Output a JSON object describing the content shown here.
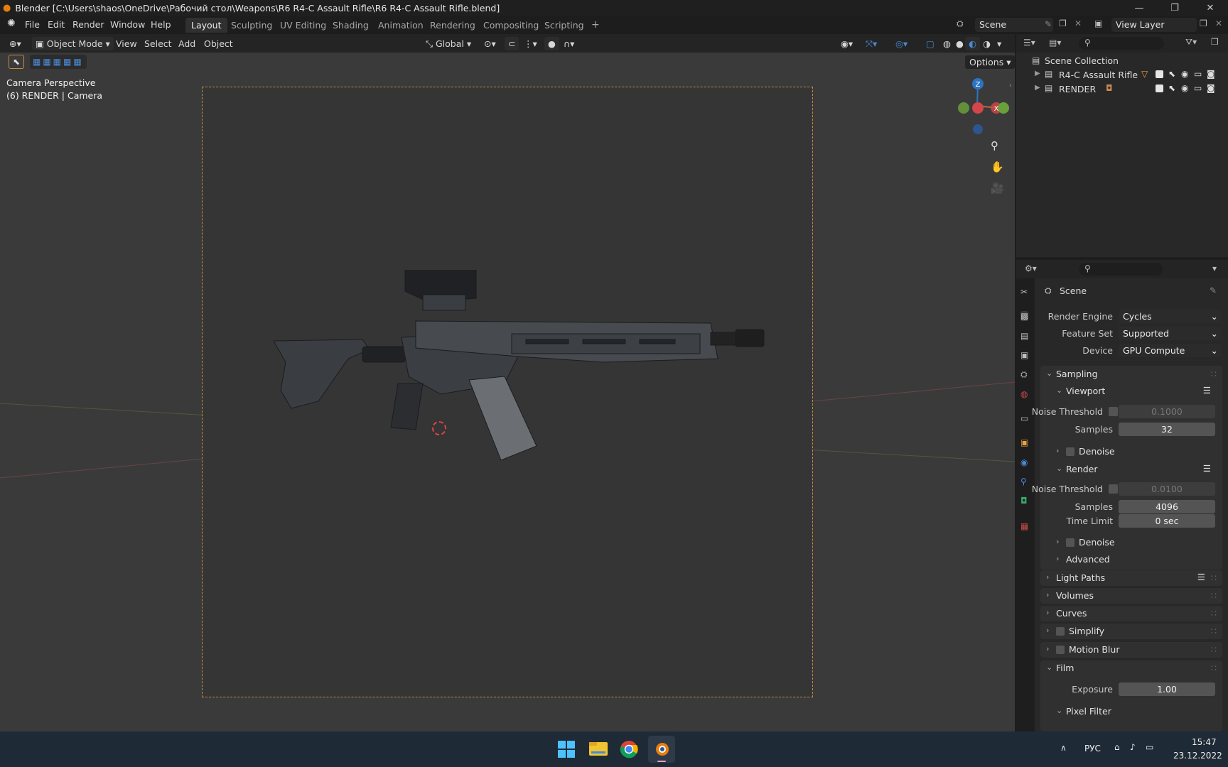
{
  "window": {
    "title": "Blender [C:\\Users\\shaos\\OneDrive\\Рабочий стол\\Weapons\\R6 R4-C Assault Rifle\\R6 R4-C Assault Rifle.blend]",
    "minimize": "—",
    "maximize": "❐",
    "close": "✕"
  },
  "menu": [
    "File",
    "Edit",
    "Render",
    "Window",
    "Help"
  ],
  "workspaces": [
    "Layout",
    "Sculpting",
    "UV Editing",
    "Shading",
    "Animation",
    "Rendering",
    "Compositing",
    "Scripting",
    "+"
  ],
  "scene": {
    "label": "Scene",
    "view_layer": "View Layer"
  },
  "viewport_header": {
    "mode": "Object Mode",
    "view": "View",
    "select": "Select",
    "add": "Add",
    "object": "Object",
    "orientation": "Global",
    "options": "Options"
  },
  "overlay": {
    "line1": "Camera Perspective",
    "line2": "(6) RENDER | Camera"
  },
  "gizmo": {
    "z": "Z",
    "y": "Y",
    "x": "X"
  },
  "outliner": {
    "root": "Scene Collection",
    "items": [
      {
        "name": "R4-C Assault Rifle"
      },
      {
        "name": "RENDER"
      }
    ]
  },
  "properties": {
    "context": "Scene",
    "render_engine_label": "Render Engine",
    "render_engine": "Cycles",
    "feature_set_label": "Feature Set",
    "feature_set": "Supported",
    "device_label": "Device",
    "device": "GPU Compute",
    "sampling": "Sampling",
    "viewport": "Viewport",
    "vp_noise_label": "Noise Threshold",
    "vp_noise": "0.1000",
    "vp_samples_label": "Samples",
    "vp_samples": "32",
    "denoise": "Denoise",
    "render": "Render",
    "r_noise_label": "Noise Threshold",
    "r_noise": "0.0100",
    "r_samples_label": "Samples",
    "r_samples": "4096",
    "time_limit_label": "Time Limit",
    "time_limit": "0 sec",
    "denoise2": "Denoise",
    "advanced": "Advanced",
    "light_paths": "Light Paths",
    "volumes": "Volumes",
    "curves": "Curves",
    "simplify": "Simplify",
    "motion_blur": "Motion Blur",
    "film": "Film",
    "exposure_label": "Exposure",
    "exposure": "1.00",
    "pixel_filter": "Pixel Filter"
  },
  "taskbar": {
    "lang": "РУС",
    "time": "15:47",
    "date": "23.12.2022"
  },
  "colors": {
    "accent_blue": "#4772b3",
    "camera_frame": "#c88a3e",
    "axis_x": "#d4464a",
    "axis_y": "#6aa03b",
    "axis_z": "#2d73c4"
  }
}
